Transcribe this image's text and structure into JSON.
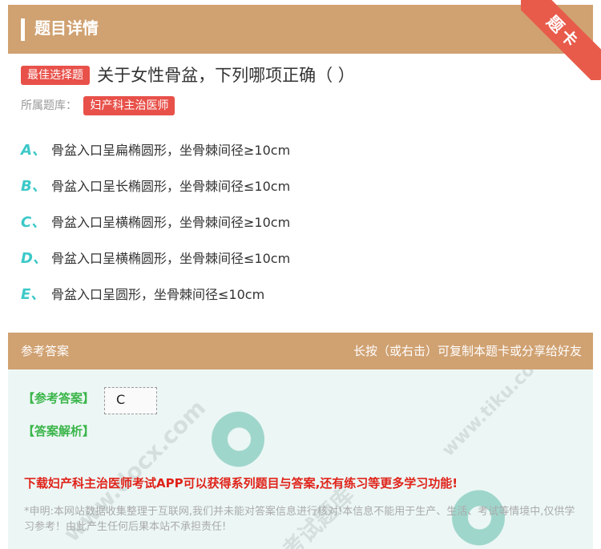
{
  "header": {
    "title": "题目详情",
    "ribbon": "题卡"
  },
  "question": {
    "type_tag": "最佳选择题",
    "text": "关于女性骨盆，下列哪项正确（ ）",
    "bank_label": "所属题库：",
    "bank_tag": "妇产科主治医师"
  },
  "options": [
    {
      "letter": "A、",
      "text": "骨盆入口呈扁椭圆形，坐骨棘间径≥10cm"
    },
    {
      "letter": "B、",
      "text": "骨盆入口呈长椭圆形，坐骨棘间径≤10cm"
    },
    {
      "letter": "C、",
      "text": "骨盆入口呈横椭圆形，坐骨棘间径≥10cm"
    },
    {
      "letter": "D、",
      "text": "骨盆入口呈横椭圆形，坐骨棘间径≤10cm"
    },
    {
      "letter": "E、",
      "text": "骨盆入口呈圆形，坐骨棘间径≤10cm"
    }
  ],
  "answer": {
    "head_left": "参考答案",
    "head_right": "长按（或右击）可复制本题卡或分享给好友",
    "ref_label": "【参考答案】",
    "ref_value": "C",
    "analysis_label": "【答案解析】",
    "download": "下载妇产科主治医师考试APP可以获得系列题目与答案,还有练习等更多学习功能!",
    "disclaimer": "*申明:本网站数据收集整理于互联网,我们并未能对答案信息进行核对!本信息不能用于生产、生活、考试等情境中,仅供学习参考！由此产生任何后果本站不承担责任!"
  },
  "watermarks": [
    "www.docx.com",
    "www.tiku.com",
    "考试题库"
  ],
  "colors": {
    "header_bg": "#d0a171",
    "tag_red": "#e8514a",
    "option_letter": "#3cc8c8",
    "answer_bg": "#ecf7f5",
    "label_green": "#3bb54a",
    "download_red": "#e0231a"
  }
}
